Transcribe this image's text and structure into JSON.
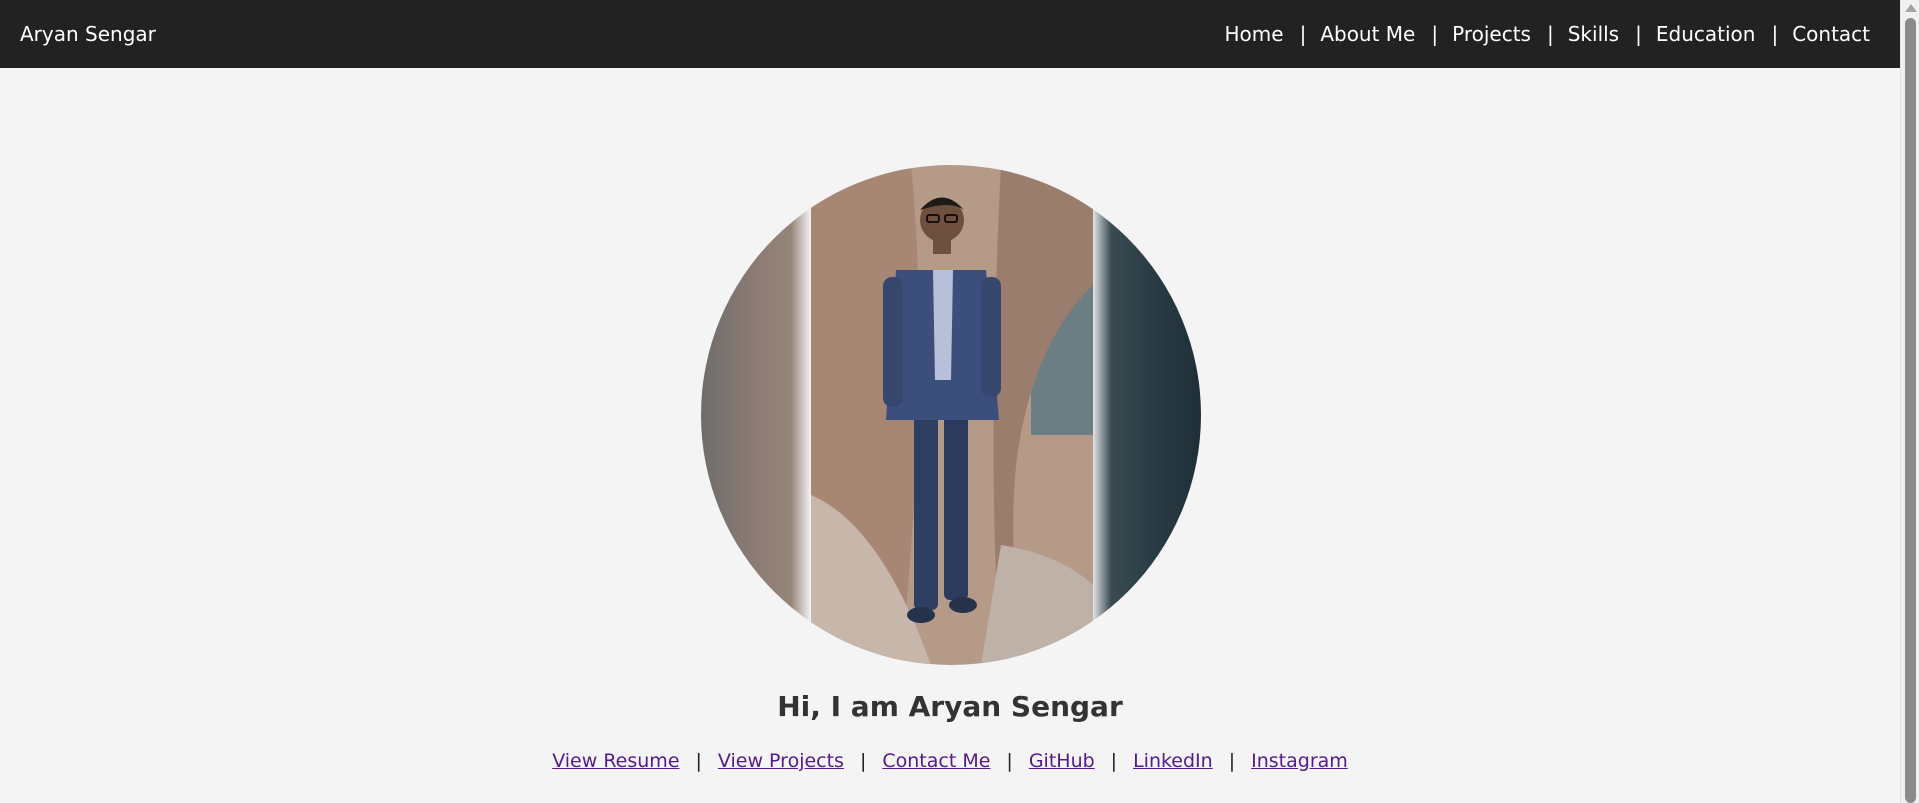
{
  "navbar": {
    "brand": "Aryan Sengar",
    "separator": "|",
    "links": [
      {
        "label": "Home"
      },
      {
        "label": "About Me"
      },
      {
        "label": "Projects"
      },
      {
        "label": "Skills"
      },
      {
        "label": "Education"
      },
      {
        "label": "Contact"
      }
    ]
  },
  "hero": {
    "greeting": "Hi, I am Aryan Sengar",
    "separator": "|",
    "links": [
      {
        "label": "View Resume"
      },
      {
        "label": "View Projects"
      },
      {
        "label": "Contact Me"
      },
      {
        "label": "GitHub"
      },
      {
        "label": "LinkedIn"
      },
      {
        "label": "Instagram"
      }
    ]
  },
  "colors": {
    "navbar_bg": "#222222",
    "page_bg": "#f4f4f4",
    "link": "#551a8b",
    "heading": "#333333"
  }
}
